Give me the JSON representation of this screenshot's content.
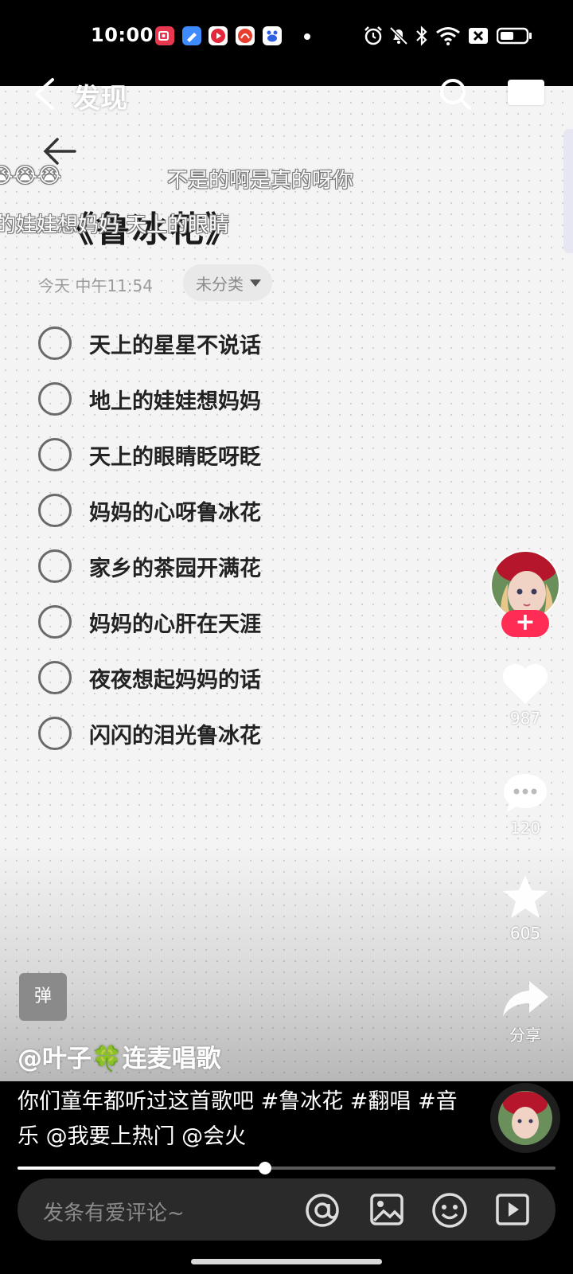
{
  "status_bar": {
    "time": "10:00",
    "app_icons": [
      "screen-recorder-icon",
      "note-app-icon",
      "video-app-icon",
      "huawei-app-icon",
      "baidu-icon"
    ],
    "system_icons": [
      "alarm-icon",
      "mute-icon",
      "bluetooth-icon",
      "wifi-icon",
      "close-box-icon",
      "battery-icon"
    ]
  },
  "top_nav": {
    "title": "发现",
    "back_icon": "chevron-left-icon",
    "search_icon": "search-icon"
  },
  "note": {
    "title": "《鲁冰花》",
    "date": "今天 中午11:54",
    "category": "未分类",
    "items": [
      "天上的星星不说话",
      "地上的娃娃想妈妈",
      "天上的眼睛眨呀眨",
      "妈妈的心呀鲁冰花",
      "家乡的茶园开满花",
      "妈妈的心肝在天涯",
      "夜夜想起妈妈的话",
      "闪闪的泪光鲁冰花"
    ]
  },
  "danmaku": [
    {
      "text": "😭😭😭"
    },
    {
      "text": "不是的啊是真的呀你"
    },
    {
      "text": "的娃娃想妈妈 天上的眼睛"
    }
  ],
  "actions": {
    "follow_label": "+",
    "like_count": "987",
    "comment_count": "120",
    "favorite_count": "605",
    "share_label": "分享"
  },
  "author": {
    "name": "@叶子🍀连麦唱歌",
    "badge": "弹"
  },
  "caption": "你们童年都听过这首歌吧 #鲁冰花 #翻唱 #音乐 @我要上热门 @会火",
  "progress": {
    "fraction": 0.46
  },
  "comment_bar": {
    "placeholder": "发条有爱评论~"
  },
  "colors": {
    "accent": "#ff2c55",
    "background": "#000000"
  }
}
